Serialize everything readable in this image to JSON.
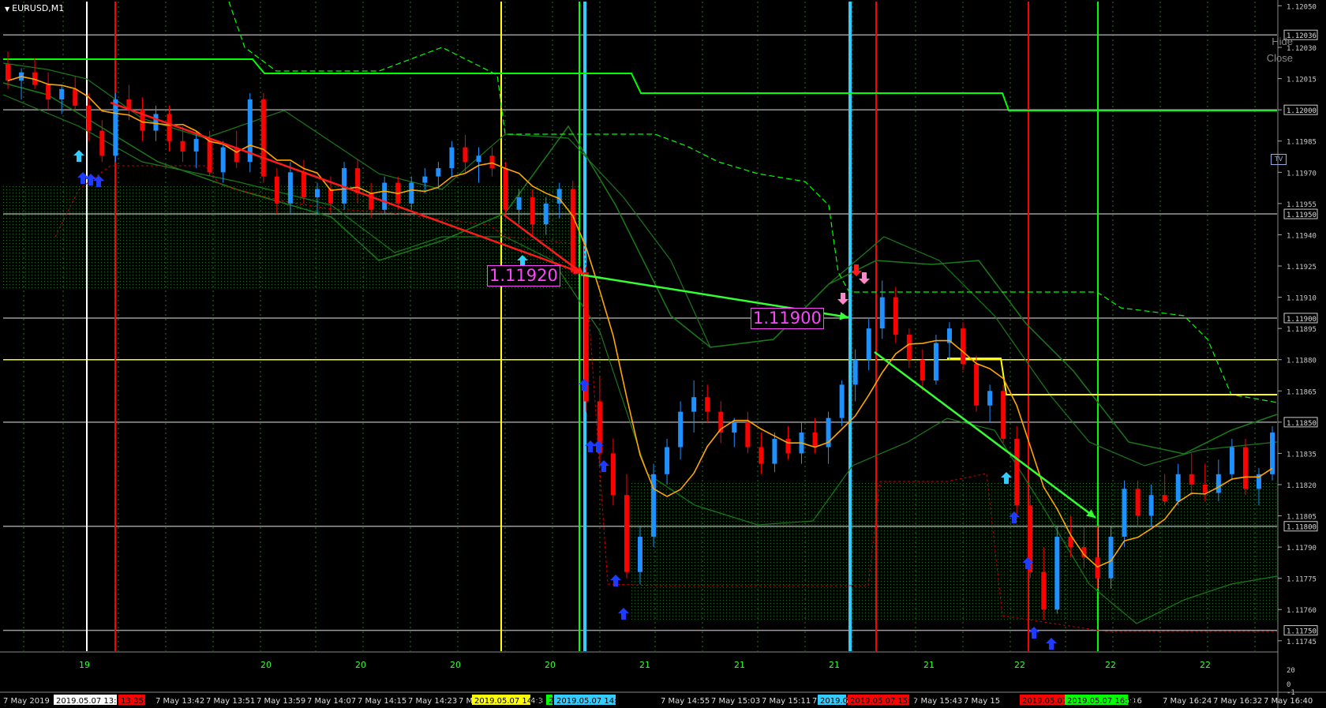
{
  "window": {
    "title": "EURUSD,M1",
    "hide_label": "Hide",
    "close_label": "Close",
    "tv_label": "TV"
  },
  "labels": {
    "price1": "1.11920",
    "price2": "1.11900"
  },
  "colors": {
    "background": "#000000",
    "grid": "#1f7a1f",
    "bull": "#1e90ff",
    "bear": "#ff0000",
    "ma": "#ffa500",
    "band": "#1a7a1a",
    "level_green": "#00ff00",
    "level_yellow": "#ffff00",
    "arrow_red": "#ff1a1a",
    "arrow_green": "#33ff33",
    "cyan": "#33ccff",
    "magenta": "#ff44ff"
  },
  "price_axis": {
    "ticks": [
      "1.12050",
      "1.12030",
      "1.12015",
      "1.12000",
      "1.11985",
      "1.11970",
      "1.11955",
      "1.11940",
      "1.11925",
      "1.11910",
      "1.11895",
      "1.11880",
      "1.11865",
      "1.11850",
      "1.11835",
      "1.11820",
      "1.11805",
      "1.11790",
      "1.11775",
      "1.11760",
      "1.11745"
    ],
    "boxed": [
      "1.12036",
      "1.12000",
      "1.11950",
      "1.11900",
      "1.11850",
      "1.11800",
      "1.11750"
    ],
    "sub_ticks": [
      "20",
      "0",
      "-1"
    ]
  },
  "sub_panel": {
    "values": [
      "19",
      "20",
      "20",
      "20",
      "20",
      "21",
      "21",
      "21",
      "21",
      "22",
      "22",
      "22"
    ]
  },
  "time_axis": {
    "labels": [
      "7 May 2019",
      "7 May 13:42",
      "7 May 13:51",
      "7 May 13:59",
      "7 May 14:07",
      "7 May 14:15",
      "7 May 14:23",
      "7 M",
      "4:3",
      "7 May 14:55",
      "7 May 15:03",
      "7 May 15:11",
      "7 May 15:19",
      "7",
      "7 May 15:43",
      "7 May 15",
      "y 16:16",
      "7 May 16:24",
      "7 May 16:32",
      "7 May 16:40"
    ],
    "tags": [
      {
        "text": "2019.05.07 13:31",
        "bg": "#ffffff",
        "fg": "#000000"
      },
      {
        "text": "13:35:5",
        "bg": "#ff0000",
        "fg": "#000000"
      },
      {
        "text": "2019.05.07 14:38",
        "bg": "#ffff00",
        "fg": "#000000"
      },
      {
        "text": "2",
        "bg": "#00ff00",
        "fg": "#000000"
      },
      {
        "text": "2019.05.07 14:51",
        "bg": "#33ccff",
        "fg": "#000000"
      },
      {
        "text": "2019.0",
        "bg": "#33ccff",
        "fg": "#000000"
      },
      {
        "text": "2019.05.07 15:37",
        "bg": "#ff0000",
        "fg": "#000000"
      },
      {
        "text": "2019.05.07 16:02",
        "bg": "#ff0000",
        "fg": "#000000"
      },
      {
        "text": "2019.05.07 16:13",
        "bg": "#00ff00",
        "fg": "#000000"
      }
    ]
  },
  "vertical_lines": [
    {
      "color": "#ffffff",
      "time": "2019.05.07 13:31"
    },
    {
      "color": "#ff0000",
      "time": "13:35"
    },
    {
      "color": "#ffff00",
      "time": "2019.05.07 14:38"
    },
    {
      "color": "#00ff00",
      "time": "14:49"
    },
    {
      "color": "#33ccff",
      "time": "2019.05.07 14:51"
    },
    {
      "color": "#33ccff",
      "time": "15:35"
    },
    {
      "color": "#ff0000",
      "time": "2019.05.07 15:37"
    },
    {
      "color": "#ff0000",
      "time": "2019.05.07 16:02"
    },
    {
      "color": "#00ff00",
      "time": "2019.05.07 16:13"
    }
  ],
  "horizontal_levels": [
    {
      "price": 1.12036,
      "color": "#9a9a9a"
    },
    {
      "price": 1.12,
      "color": "#9a9a9a"
    },
    {
      "price": 1.1195,
      "color": "#9a9a9a"
    },
    {
      "price": 1.119,
      "color": "#9a9a9a"
    },
    {
      "price": 1.1185,
      "color": "#9a9a9a"
    },
    {
      "price": 1.118,
      "color": "#9a9a9a"
    },
    {
      "price": 1.1175,
      "color": "#9a9a9a"
    },
    {
      "price": 1.1188,
      "color": "#ffff00"
    }
  ],
  "chart_data": {
    "type": "candlestick",
    "symbol": "EURUSD",
    "timeframe": "M1",
    "ylim": [
      1.1174,
      1.12052
    ],
    "candles": [
      [
        1.12022,
        1.12028,
        1.1201,
        1.12014
      ],
      [
        1.12014,
        1.1202,
        1.12005,
        1.12018
      ],
      [
        1.12018,
        1.12025,
        1.1201,
        1.12012
      ],
      [
        1.12012,
        1.12018,
        1.12,
        1.12005
      ],
      [
        1.12005,
        1.12012,
        1.11998,
        1.1201
      ],
      [
        1.1201,
        1.12016,
        1.12,
        1.12002
      ],
      [
        1.12002,
        1.12008,
        1.11985,
        1.1199
      ],
      [
        1.1199,
        1.11995,
        1.11975,
        1.11978
      ],
      [
        1.11978,
        1.12008,
        1.11975,
        1.12005
      ],
      [
        1.12005,
        1.12012,
        1.11995,
        1.12
      ],
      [
        1.12,
        1.12006,
        1.11985,
        1.1199
      ],
      [
        1.1199,
        1.12002,
        1.11985,
        1.11998
      ],
      [
        1.11998,
        1.12002,
        1.1198,
        1.11985
      ],
      [
        1.11985,
        1.11992,
        1.11975,
        1.1198
      ],
      [
        1.1198,
        1.1199,
        1.11972,
        1.11986
      ],
      [
        1.11986,
        1.1199,
        1.11968,
        1.1197
      ],
      [
        1.1197,
        1.11985,
        1.11965,
        1.11982
      ],
      [
        1.11982,
        1.1199,
        1.11972,
        1.11975
      ],
      [
        1.11975,
        1.12008,
        1.1197,
        1.12005
      ],
      [
        1.12005,
        1.12008,
        1.11965,
        1.11968
      ],
      [
        1.11968,
        1.11972,
        1.1195,
        1.11955
      ],
      [
        1.11955,
        1.11975,
        1.1195,
        1.1197
      ],
      [
        1.1197,
        1.11976,
        1.11955,
        1.11958
      ],
      [
        1.11958,
        1.11965,
        1.1195,
        1.11962
      ],
      [
        1.11962,
        1.11968,
        1.1195,
        1.11955
      ],
      [
        1.11955,
        1.11975,
        1.11952,
        1.11972
      ],
      [
        1.11972,
        1.11976,
        1.11955,
        1.1196
      ],
      [
        1.1196,
        1.11965,
        1.11948,
        1.11952
      ],
      [
        1.11952,
        1.11968,
        1.1195,
        1.11965
      ],
      [
        1.11965,
        1.11968,
        1.11952,
        1.11955
      ],
      [
        1.11955,
        1.11968,
        1.11952,
        1.11965
      ],
      [
        1.11965,
        1.11972,
        1.1196,
        1.11968
      ],
      [
        1.11968,
        1.11975,
        1.11962,
        1.11972
      ],
      [
        1.11972,
        1.11985,
        1.11968,
        1.11982
      ],
      [
        1.11982,
        1.11988,
        1.1197,
        1.11975
      ],
      [
        1.11975,
        1.11982,
        1.11965,
        1.11978
      ],
      [
        1.11978,
        1.11982,
        1.11968,
        1.11972
      ],
      [
        1.11972,
        1.11975,
        1.1195,
        1.11952
      ],
      [
        1.11952,
        1.11962,
        1.11945,
        1.11958
      ],
      [
        1.11958,
        1.11962,
        1.1194,
        1.11945
      ],
      [
        1.11945,
        1.11958,
        1.1194,
        1.11955
      ],
      [
        1.11955,
        1.11965,
        1.11948,
        1.11962
      ],
      [
        1.11962,
        1.11966,
        1.1194,
        1.11922
      ],
      [
        1.11922,
        1.11925,
        1.11855,
        1.1186
      ],
      [
        1.1186,
        1.11872,
        1.1183,
        1.11835
      ],
      [
        1.11835,
        1.11842,
        1.1181,
        1.11815
      ],
      [
        1.11815,
        1.11825,
        1.11775,
        1.11778
      ],
      [
        1.11778,
        1.118,
        1.11772,
        1.11795
      ],
      [
        1.11795,
        1.1183,
        1.1179,
        1.11825
      ],
      [
        1.11825,
        1.11842,
        1.1182,
        1.11838
      ],
      [
        1.11838,
        1.1186,
        1.11832,
        1.11855
      ],
      [
        1.11855,
        1.1187,
        1.11845,
        1.11862
      ],
      [
        1.11862,
        1.11868,
        1.1185,
        1.11855
      ],
      [
        1.11855,
        1.1186,
        1.1184,
        1.11845
      ],
      [
        1.11845,
        1.11852,
        1.11838,
        1.1185
      ],
      [
        1.1185,
        1.11855,
        1.11835,
        1.11838
      ],
      [
        1.11838,
        1.11845,
        1.11825,
        1.1183
      ],
      [
        1.1183,
        1.11845,
        1.11826,
        1.11842
      ],
      [
        1.11842,
        1.11848,
        1.11832,
        1.11835
      ],
      [
        1.11835,
        1.1185,
        1.1183,
        1.11845
      ],
      [
        1.11845,
        1.11852,
        1.11835,
        1.11838
      ],
      [
        1.11838,
        1.11855,
        1.1183,
        1.11852
      ],
      [
        1.11852,
        1.1187,
        1.11848,
        1.11868
      ],
      [
        1.11868,
        1.11885,
        1.1186,
        1.1188
      ],
      [
        1.1188,
        1.119,
        1.11875,
        1.11895
      ],
      [
        1.11895,
        1.11918,
        1.1189,
        1.1191
      ],
      [
        1.1191,
        1.11915,
        1.11888,
        1.11892
      ],
      [
        1.11892,
        1.11895,
        1.11876,
        1.1188
      ],
      [
        1.1188,
        1.11885,
        1.11865,
        1.1187
      ],
      [
        1.1187,
        1.11892,
        1.11868,
        1.11888
      ],
      [
        1.11888,
        1.11898,
        1.1188,
        1.11895
      ],
      [
        1.11895,
        1.11898,
        1.11875,
        1.11878
      ],
      [
        1.11878,
        1.11882,
        1.11855,
        1.11858
      ],
      [
        1.11858,
        1.11868,
        1.1185,
        1.11865
      ],
      [
        1.11865,
        1.11868,
        1.1184,
        1.11842
      ],
      [
        1.11842,
        1.11848,
        1.11805,
        1.1181
      ],
      [
        1.1181,
        1.11815,
        1.11775,
        1.11778
      ],
      [
        1.11778,
        1.1179,
        1.11755,
        1.1176
      ],
      [
        1.1176,
        1.118,
        1.11758,
        1.11795
      ],
      [
        1.11795,
        1.11805,
        1.11785,
        1.1179
      ],
      [
        1.1179,
        1.118,
        1.1178,
        1.11785
      ],
      [
        1.11785,
        1.118,
        1.1177,
        1.11775
      ],
      [
        1.11775,
        1.118,
        1.1177,
        1.11795
      ],
      [
        1.11795,
        1.11822,
        1.1179,
        1.11818
      ],
      [
        1.11818,
        1.11822,
        1.118,
        1.11805
      ],
      [
        1.11805,
        1.1182,
        1.118,
        1.11815
      ],
      [
        1.11815,
        1.11825,
        1.1181,
        1.11812
      ],
      [
        1.11812,
        1.1183,
        1.1181,
        1.11825
      ],
      [
        1.11825,
        1.11835,
        1.11815,
        1.1182
      ],
      [
        1.1182,
        1.1183,
        1.11812,
        1.11816
      ],
      [
        1.11816,
        1.11832,
        1.11812,
        1.11825
      ],
      [
        1.11825,
        1.11842,
        1.11822,
        1.11838
      ],
      [
        1.11838,
        1.11842,
        1.11815,
        1.11818
      ],
      [
        1.11818,
        1.11828,
        1.1181,
        1.11825
      ],
      [
        1.11825,
        1.11848,
        1.11822,
        1.11845
      ]
    ]
  }
}
